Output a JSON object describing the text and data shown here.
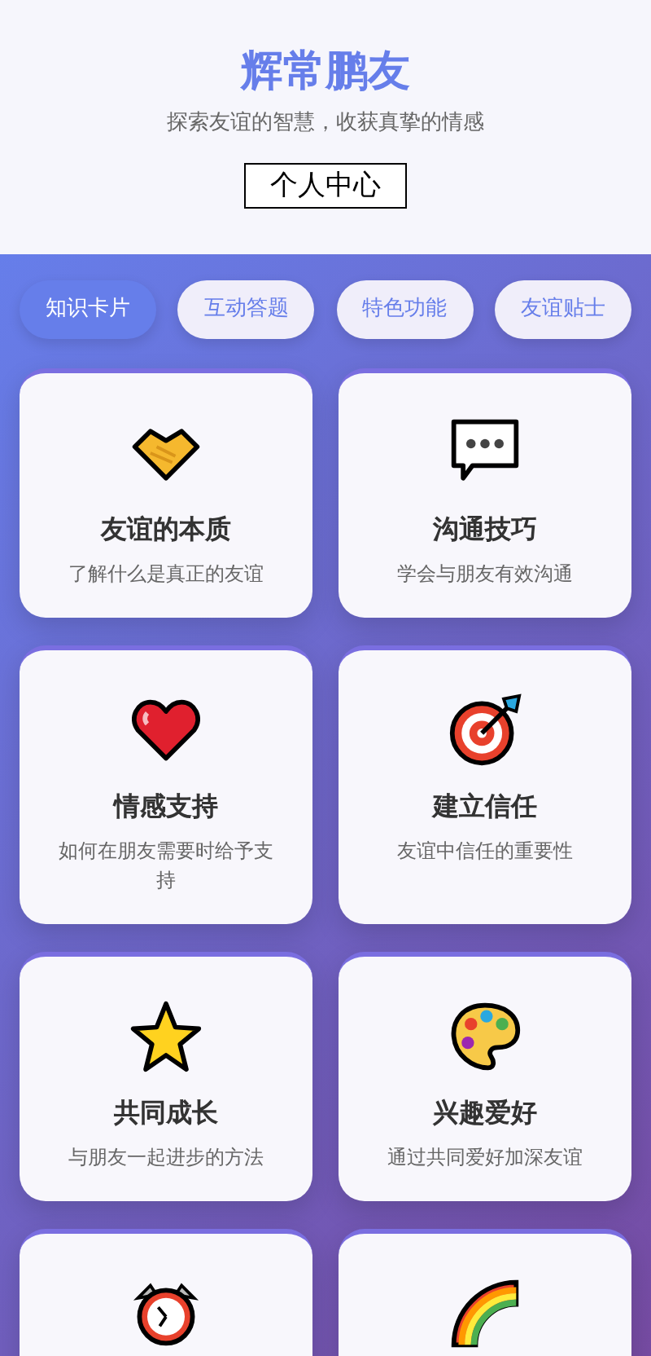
{
  "header": {
    "title": "辉常鹏友",
    "subtitle": "探索友谊的智慧，收获真挚的情感",
    "button": "个人中心"
  },
  "tabs": [
    {
      "label": "知识卡片",
      "selected": true
    },
    {
      "label": "互动答题",
      "selected": false
    },
    {
      "label": "特色功能",
      "selected": false
    },
    {
      "label": "友谊贴士",
      "selected": false
    }
  ],
  "cards": [
    {
      "kind": "topic",
      "title": "友谊的本质",
      "description": "了解什么是真正的友谊"
    },
    {
      "kind": "topic",
      "title": "沟通技巧",
      "description": "学会与朋友有效沟通"
    },
    {
      "kind": "topic",
      "title": "情感支持",
      "description": "如何在朋友需要时给予支持"
    },
    {
      "kind": "topic",
      "title": "建立信任",
      "description": "友谊中信任的重要性"
    },
    {
      "kind": "topic",
      "title": "共同成长",
      "description": "与朋友一起进步的方法"
    },
    {
      "kind": "topic",
      "title": "兴趣爱好",
      "description": "通过共同爱好加深友谊"
    },
    {
      "kind": "topic"
    },
    {
      "kind": "topic"
    }
  ]
}
